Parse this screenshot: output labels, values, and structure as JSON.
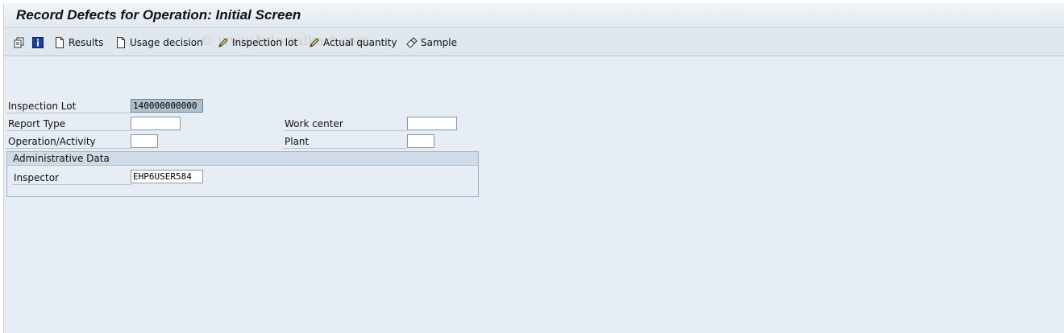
{
  "window": {
    "title": "Record Defects for Operation: Initial Screen"
  },
  "toolbar": {
    "items": [
      {
        "label": "",
        "icon": "multi-document-icon"
      },
      {
        "label": "",
        "icon": "info-icon"
      },
      {
        "label": "Results",
        "icon": "document-icon"
      },
      {
        "label": "Usage decision",
        "icon": "document-icon"
      },
      {
        "label": "Inspection lot",
        "icon": "pencil-icon"
      },
      {
        "label": "Actual quantity",
        "icon": "pencil-icon"
      },
      {
        "label": "Sample",
        "icon": "eraser-pencil-icon"
      }
    ],
    "watermark": "© www.tutorialkart.com"
  },
  "form": {
    "inspection_lot": {
      "label": "Inspection Lot",
      "value": "140000000000"
    },
    "report_type": {
      "label": "Report Type",
      "value": ""
    },
    "operation_activity": {
      "label": "Operation/Activity",
      "value": ""
    },
    "work_center": {
      "label": "Work center",
      "value": ""
    },
    "plant": {
      "label": "Plant",
      "value": ""
    }
  },
  "admin": {
    "title": "Administrative Data",
    "inspector": {
      "label": "Inspector",
      "value": "EHP6USER584"
    }
  },
  "colors": {
    "background": "#e6edf4",
    "toolbar": "#dfe7ef",
    "selection": "#aebfd0"
  }
}
